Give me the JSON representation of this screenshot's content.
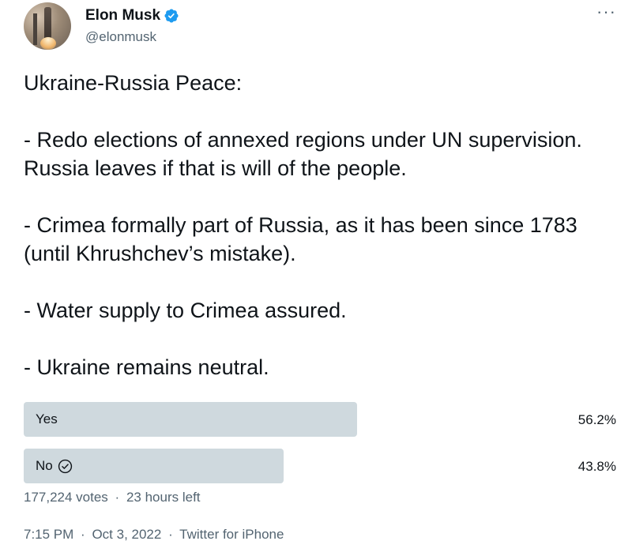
{
  "user": {
    "display_name": "Elon Musk",
    "handle": "@elonmusk",
    "verified_icon": "verified-badge-icon",
    "more_icon": "more-horizontal-icon",
    "more_glyph": "···"
  },
  "tweet": {
    "text": "Ukraine-Russia Peace:\n\n- Redo elections of annexed regions under UN supervision. Russia leaves if that is will of the people.\n\n- Crimea formally part of Russia, as it has been since 1783 (until Khrushchev’s mistake).\n\n- Water supply to Crimea assured.\n\n- Ukraine remains neutral."
  },
  "poll": {
    "options": [
      {
        "label": "Yes",
        "percent_text": "56.2%",
        "fraction": 0.562,
        "winner": false
      },
      {
        "label": "No",
        "percent_text": "43.8%",
        "fraction": 0.438,
        "winner": true
      }
    ],
    "votes": "177,224 votes",
    "time_left": "23 hours left",
    "separator": "·"
  },
  "meta": {
    "time": "7:15 PM",
    "date": "Oct 3, 2022",
    "source": "Twitter for iPhone",
    "separator": "·"
  },
  "colors": {
    "verified": "#1d9bf0",
    "bar": "#cfd9de",
    "secondary_text": "#536471"
  }
}
